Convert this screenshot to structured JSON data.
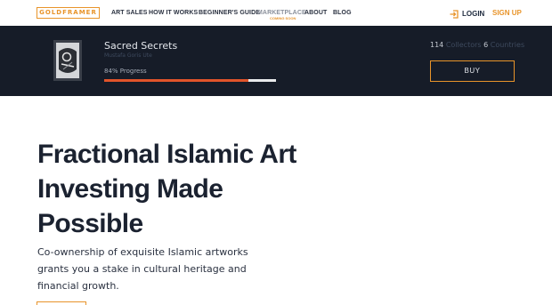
{
  "nav": {
    "logo": "GOLDFRAMER",
    "items": [
      "ART SALES",
      "HOW IT WORKS",
      "BEGINNER'S GUIDE",
      "MARKETPLACE",
      "ABOUT",
      "BLOG"
    ],
    "marketplace_badge": "COMING SOON",
    "login_label": "LOGIN",
    "signup_label": "SIGN UP"
  },
  "banner": {
    "title": "Sacred Secrets",
    "artist": "Mustafa Goris Ute",
    "progress_label": "84% Progress",
    "progress": 0.84,
    "collectors_count": "114",
    "collectors_label": "Collectors",
    "countries_count": "6",
    "countries_label": "Countries",
    "buy_label": "BUY"
  },
  "hero": {
    "title": "Fractional Islamic Art Investing Made Possible",
    "subtitle": "Co-ownership of exquisite Islamic artworks grants you a stake in cultural heritage and financial growth."
  },
  "colors": {
    "accent": "#e8942a",
    "banner_bg": "#161c28",
    "progress": "#e1542a"
  },
  "icons": {
    "login": "login-arrow-icon"
  }
}
